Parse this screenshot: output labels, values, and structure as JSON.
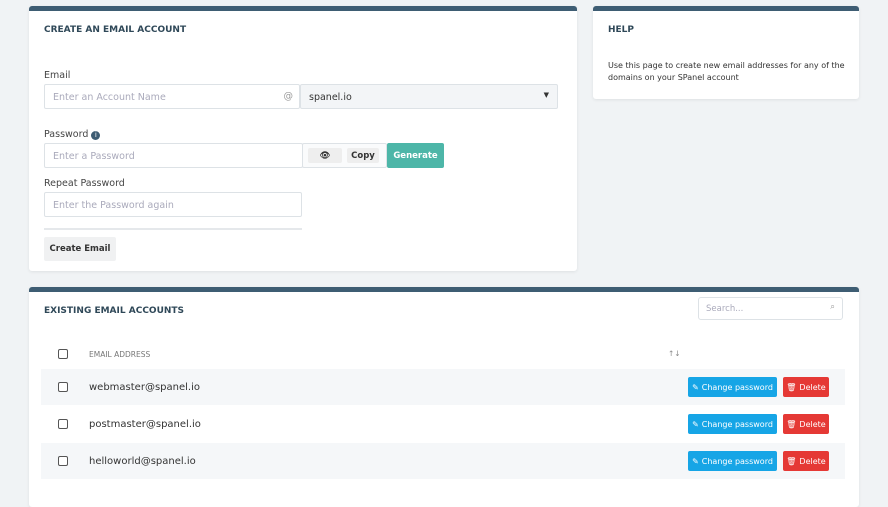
{
  "create": {
    "title": "CREATE AN EMAIL ACCOUNT",
    "email_label": "Email",
    "account_placeholder": "Enter an Account Name",
    "at": "@",
    "domain": "spanel.io",
    "password_label": "Password",
    "password_placeholder": "Enter a Password",
    "copy": "Copy",
    "generate": "Generate",
    "repeat_label": "Repeat Password",
    "repeat_placeholder": "Enter the Password again",
    "create_button": "Create Email"
  },
  "help": {
    "title": "HELP",
    "text": "Use this page to create new email addresses for any of the domains on your SPanel account"
  },
  "existing": {
    "title": "EXISTING EMAIL ACCOUNTS",
    "search_placeholder": "Search...",
    "column": "EMAIL ADDRESS",
    "sort": "↑↓",
    "change_label": "Change password",
    "delete_label": "Delete",
    "rows": [
      {
        "email": "webmaster@spanel.io"
      },
      {
        "email": "postmaster@spanel.io"
      },
      {
        "email": "helloworld@spanel.io"
      }
    ]
  }
}
